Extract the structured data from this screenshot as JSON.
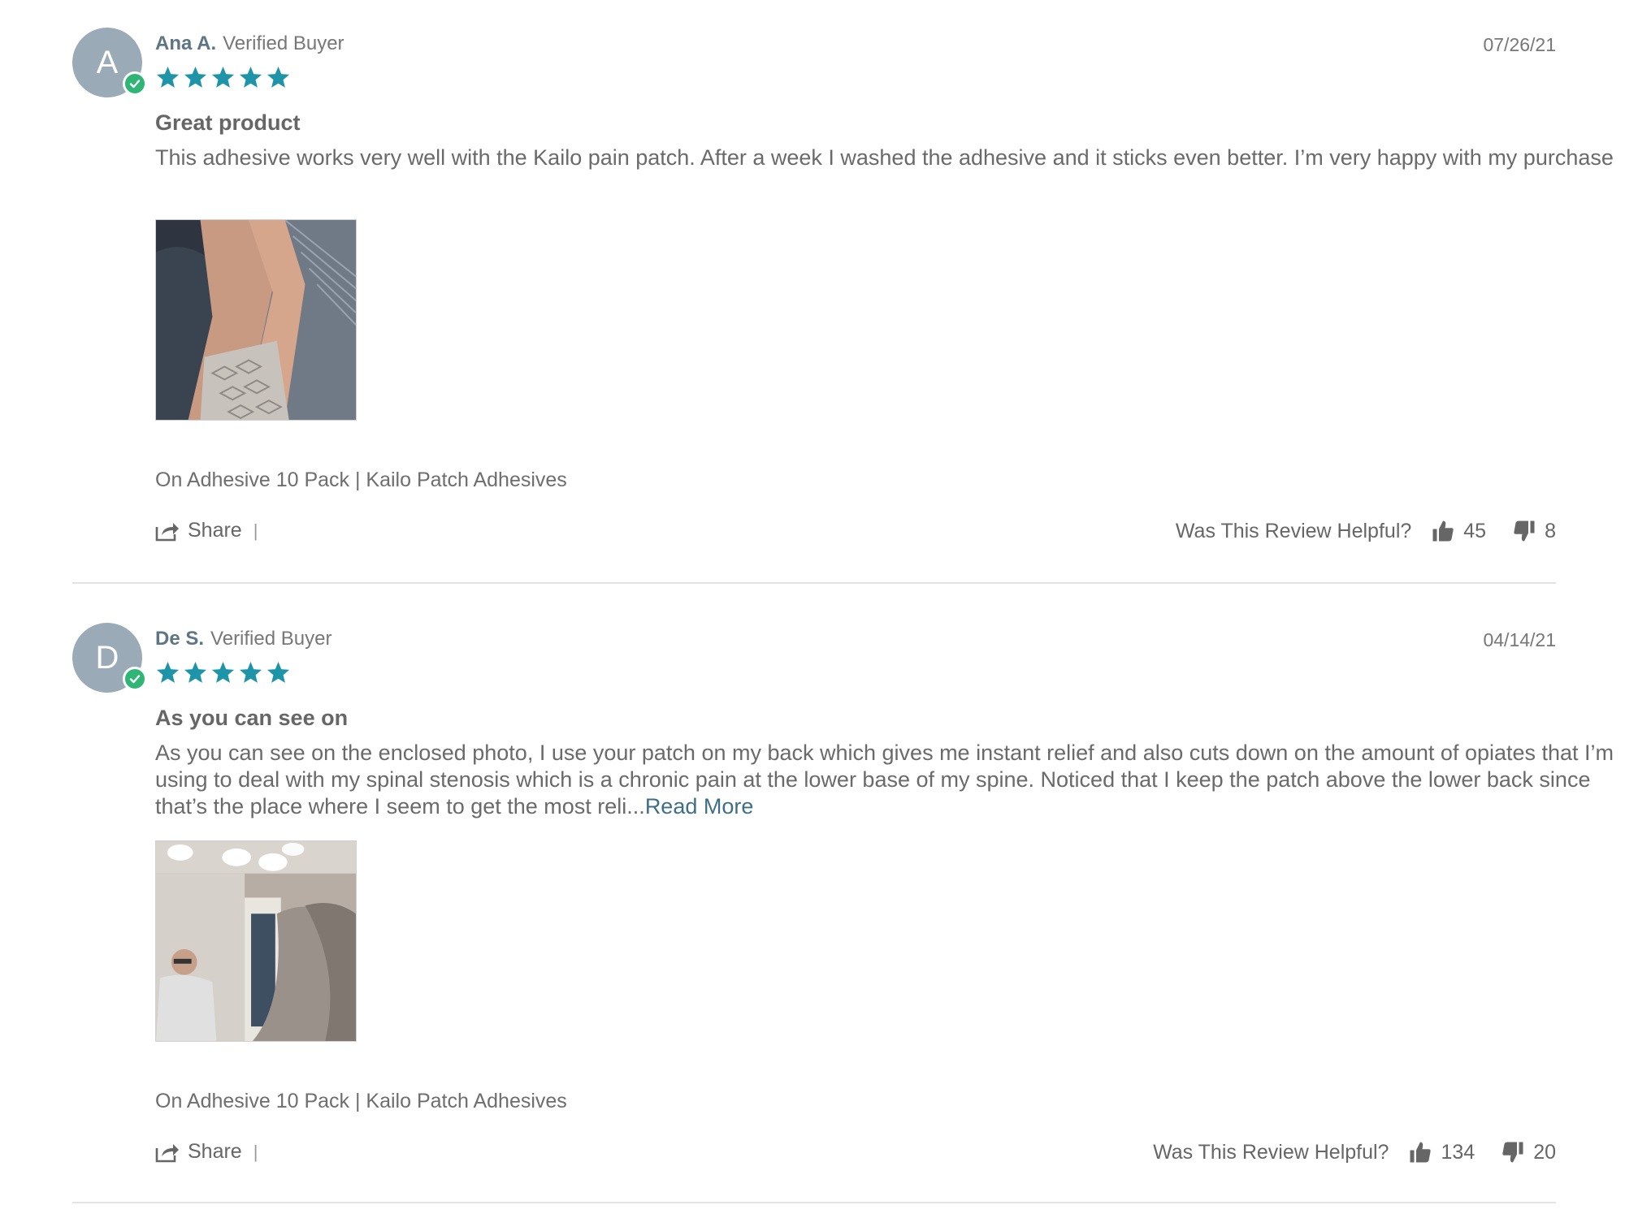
{
  "colors": {
    "star": "#1e94a8",
    "verified_badge": "#2fb676",
    "avatar_bg": "#9aabb7",
    "author": "#5d7585",
    "link": "#3e6f86",
    "divider": "#e3e3e3"
  },
  "reviews": [
    {
      "avatar_initial": "A",
      "author": "Ana A.",
      "verified_label": "Verified Buyer",
      "date": "07/26/21",
      "rating": 5,
      "title": "Great product",
      "text": "This adhesive works very well with the Kailo pain patch. After a week I washed the adhesive and it sticks even better. I’m very happy with my purchase",
      "read_more": "",
      "product": "On Adhesive 10 Pack | Kailo Patch Adhesives",
      "share_label": "Share",
      "share_separator": "|",
      "helpful_question": "Was This Review Helpful?",
      "upvotes": "45",
      "downvotes": "8"
    },
    {
      "avatar_initial": "D",
      "author": "De S.",
      "verified_label": "Verified Buyer",
      "date": "04/14/21",
      "rating": 5,
      "title": "As you can see on",
      "text": "As you can see on the enclosed photo, I use your patch on my back which gives me instant relief and also cuts down on the amount of opiates that I’m using to deal with my spinal stenosis which is a chronic pain at the lower base of my spine. Noticed that I keep the patch above the lower back since that’s the place where I seem to get the most reli...",
      "read_more": "Read More",
      "product": "On Adhesive 10 Pack | Kailo Patch Adhesives",
      "share_label": "Share",
      "share_separator": "|",
      "helpful_question": "Was This Review Helpful?",
      "upvotes": "134",
      "downvotes": "20"
    }
  ],
  "icons": {
    "verified": "check-circle-icon",
    "star": "star-icon",
    "share": "share-icon",
    "thumbs_up": "thumbs-up-icon",
    "thumbs_down": "thumbs-down-icon"
  }
}
